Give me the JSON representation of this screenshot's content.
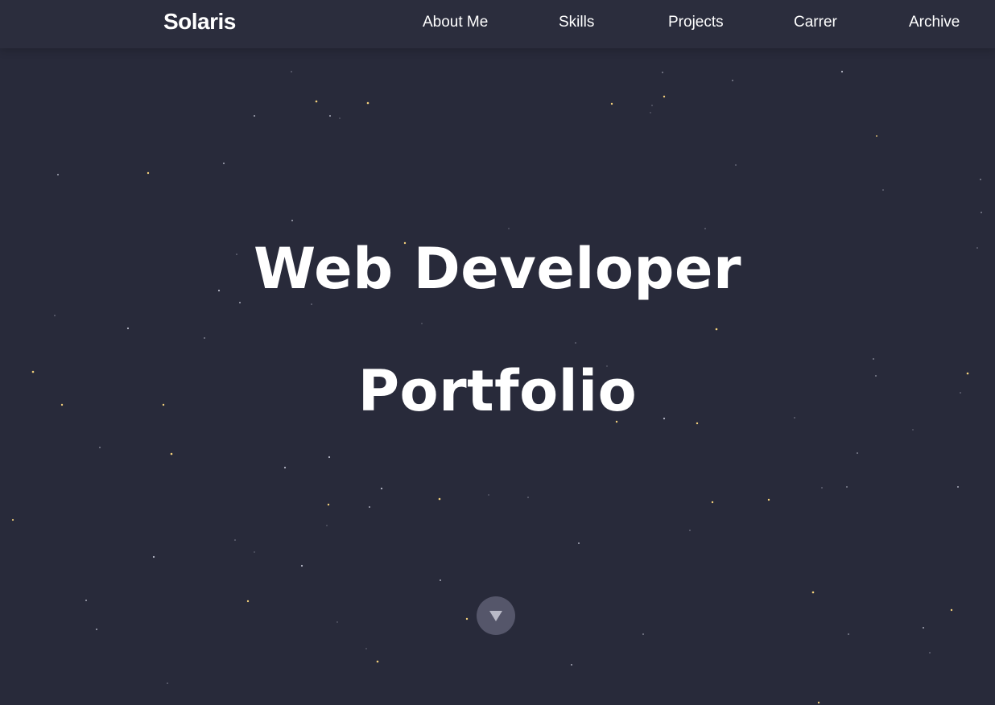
{
  "header": {
    "logo": "Solaris",
    "nav": [
      {
        "label": "About Me"
      },
      {
        "label": "Skills"
      },
      {
        "label": "Projects"
      },
      {
        "label": "Carrer"
      },
      {
        "label": "Archive"
      }
    ]
  },
  "hero": {
    "title_line_1": "Web Developer",
    "title_line_2": "Portfolio"
  },
  "scroll_button": {
    "icon": "triangle-down-icon"
  },
  "colors": {
    "background": "#282a3a",
    "navbar": "#2b2d3d",
    "text": "#ffffff",
    "star_white": "#c8cad8",
    "star_gold": "#f2cf7a",
    "scroll_button": "#55566a"
  }
}
